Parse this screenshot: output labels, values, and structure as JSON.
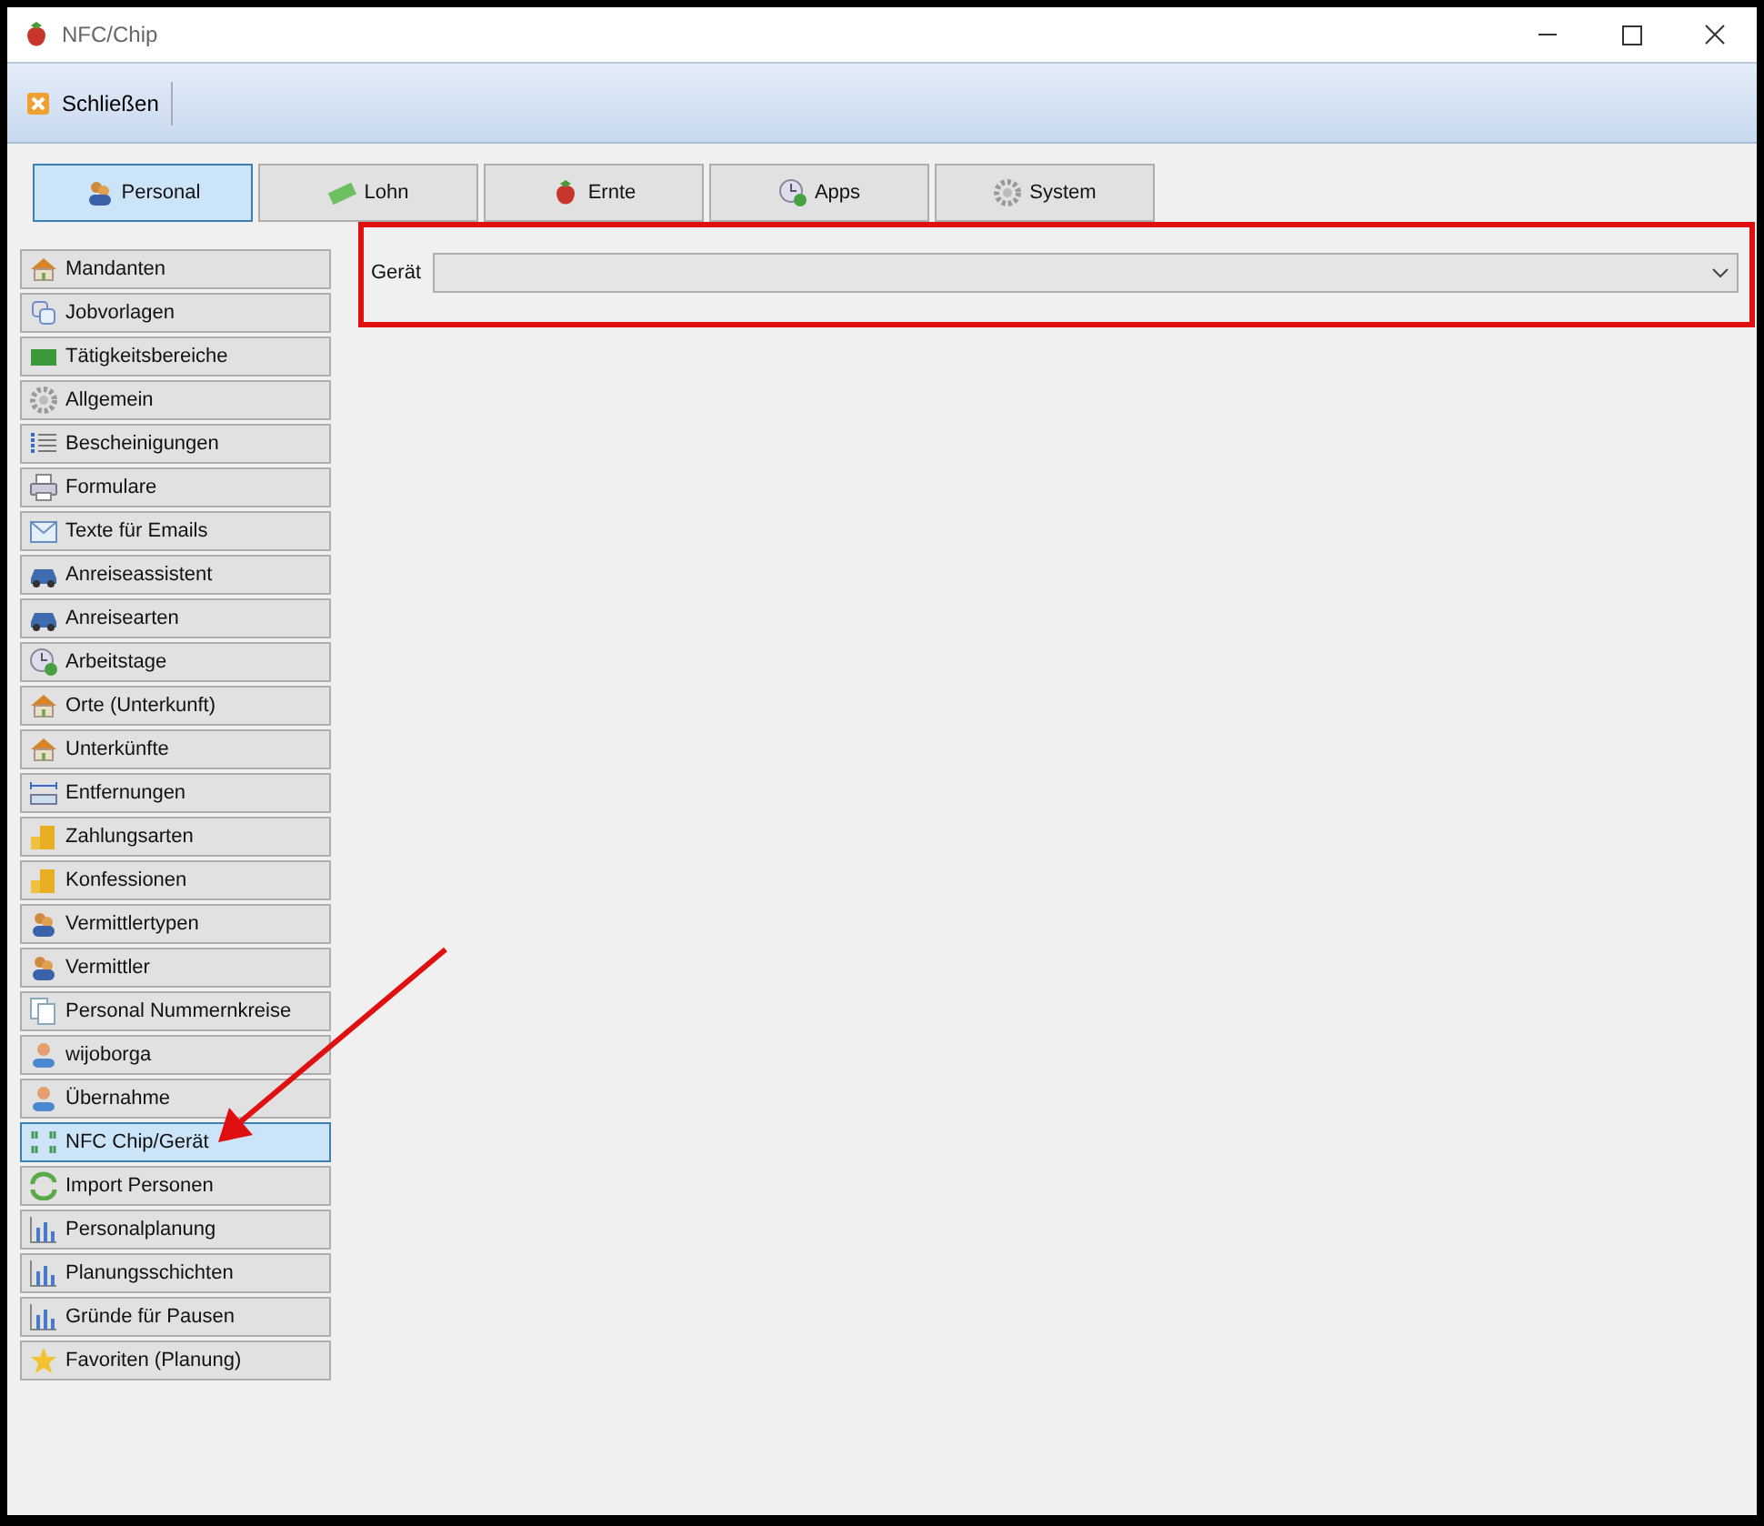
{
  "window": {
    "title": "NFC/Chip"
  },
  "toolbar": {
    "close_label": "Schließen"
  },
  "tabs": [
    {
      "label": "Personal",
      "kind": "people",
      "selected": true
    },
    {
      "label": "Lohn",
      "kind": "money",
      "selected": false
    },
    {
      "label": "Ernte",
      "kind": "berry",
      "selected": false
    },
    {
      "label": "Apps",
      "kind": "clock",
      "selected": false
    },
    {
      "label": "System",
      "kind": "gear",
      "selected": false
    }
  ],
  "sidebar": {
    "items": [
      {
        "label": "Mandanten",
        "kind": "house",
        "selected": false
      },
      {
        "label": "Jobvorlagen",
        "kind": "copy",
        "selected": false
      },
      {
        "label": "Tätigkeitsbereiche",
        "kind": "block",
        "selected": false
      },
      {
        "label": "Allgemein",
        "kind": "gear",
        "selected": false
      },
      {
        "label": "Bescheinigungen",
        "kind": "list",
        "selected": false
      },
      {
        "label": "Formulare",
        "kind": "printer",
        "selected": false
      },
      {
        "label": "Texte für Emails",
        "kind": "mail",
        "selected": false
      },
      {
        "label": "Anreiseassistent",
        "kind": "car",
        "selected": false
      },
      {
        "label": "Anreisearten",
        "kind": "car",
        "selected": false
      },
      {
        "label": "Arbeitstage",
        "kind": "clock",
        "selected": false
      },
      {
        "label": "Orte (Unterkunft)",
        "kind": "house",
        "selected": false
      },
      {
        "label": "Unterkünfte",
        "kind": "house",
        "selected": false
      },
      {
        "label": "Entfernungen",
        "kind": "ruler",
        "selected": false
      },
      {
        "label": "Zahlungsarten",
        "kind": "coins",
        "selected": false
      },
      {
        "label": "Konfessionen",
        "kind": "coins",
        "selected": false
      },
      {
        "label": "Vermittlertypen",
        "kind": "people",
        "selected": false
      },
      {
        "label": "Vermittler",
        "kind": "people",
        "selected": false
      },
      {
        "label": "Personal Nummernkreise",
        "kind": "doc",
        "selected": false
      },
      {
        "label": "wijoborga",
        "kind": "person",
        "selected": false
      },
      {
        "label": "Übernahme",
        "kind": "person",
        "selected": false
      },
      {
        "label": "NFC Chip/Gerät",
        "kind": "nfc",
        "selected": true
      },
      {
        "label": "Import Personen",
        "kind": "refresh",
        "selected": false
      },
      {
        "label": "Personalplanung",
        "kind": "chart",
        "selected": false
      },
      {
        "label": "Planungsschichten",
        "kind": "chart",
        "selected": false
      },
      {
        "label": "Gründe für Pausen",
        "kind": "chart",
        "selected": false
      },
      {
        "label": "Favoriten (Planung)",
        "kind": "star",
        "selected": false
      }
    ]
  },
  "form": {
    "device_label": "Gerät"
  }
}
